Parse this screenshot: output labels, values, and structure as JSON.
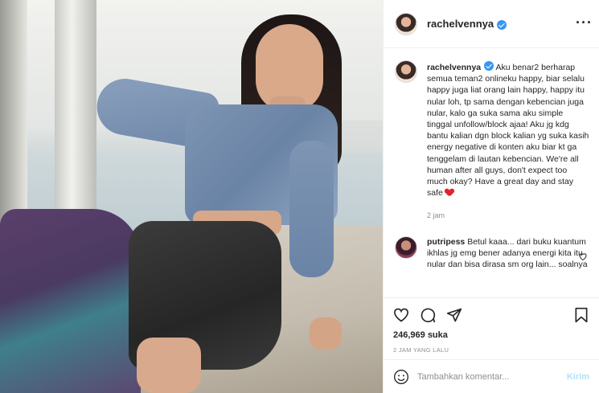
{
  "post": {
    "username": "rachelvennya",
    "caption_text": "Aku benar2 berharap semua teman2 onlineku happy, biar selalu happy juga liat orang lain happy, happy itu nular loh, tp sama dengan kebencian juga nular, kalo ga suka sama aku simple tinggal unfollow/block ajaa! Aku jg kdg bantu kalian dgn block kalian yg suka kasih energy negative di konten aku biar kt ga tenggelam di lautan kebencian. We're all human after all guys, don't expect too much okay? Have a great day and stay safe",
    "caption_time": "2 jam",
    "likes": "246,969 suka",
    "posted_ago": "2 JAM YANG LALU"
  },
  "comments": [
    {
      "username": "putripess",
      "text": "Betul kaaa... dari buku kuantum ikhlas jg emg bener adanya energi kita itu nular dan bisa dirasa sm org lain... soalnya"
    }
  ],
  "add_comment": {
    "placeholder": "Tambahkan komentar...",
    "post_label": "Kirim"
  },
  "icons": {
    "more": "more-options-icon",
    "verified": "verified-badge-icon",
    "like": "heart-icon",
    "comment": "comment-icon",
    "share": "share-icon",
    "save": "bookmark-icon",
    "emoji": "emoji-icon"
  },
  "colors": {
    "verified": "#3897f0",
    "heart": "#e0232f",
    "post_button": "#b2dffc"
  }
}
